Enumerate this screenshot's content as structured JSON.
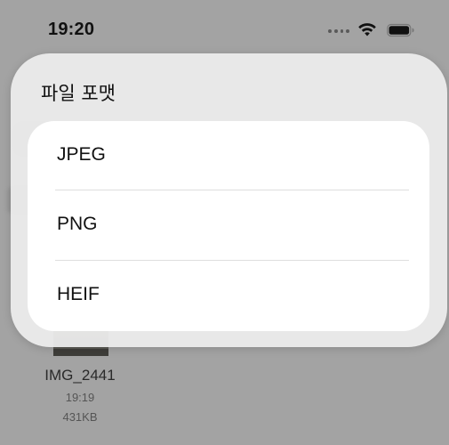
{
  "status_bar": {
    "time": "19:20",
    "icons": [
      "cellular-dots-icon",
      "wifi-icon",
      "battery-icon"
    ]
  },
  "background_item": {
    "file_name": "IMG_2441",
    "time": "19:19",
    "size": "431KB"
  },
  "format_sheet": {
    "title": "파일 포맷",
    "options": [
      {
        "label": "JPEG"
      },
      {
        "label": "PNG"
      },
      {
        "label": "HEIF"
      }
    ]
  },
  "colors": {
    "dim_background": "#a3a3a3",
    "sheet_background": "#ececec",
    "card_background": "#ffffff",
    "divider": "#dedede",
    "text": "#111111"
  }
}
